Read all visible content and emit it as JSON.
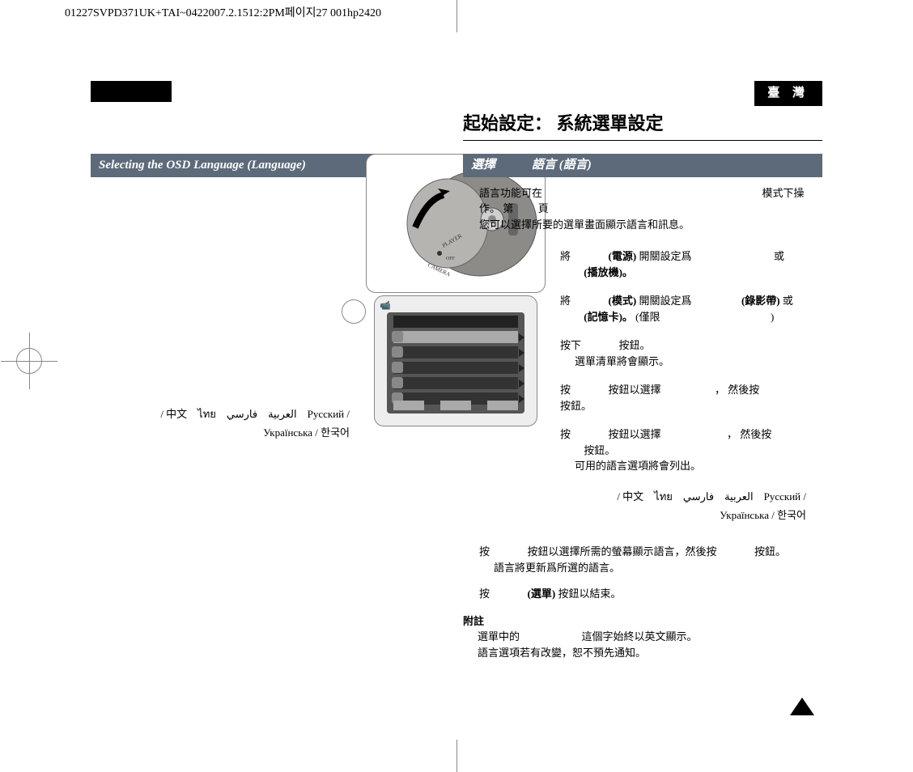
{
  "header_line": "01227SVPD371UK+TAI~0422007.2.1512:2PM페이지27 001hp2420",
  "region": "臺 灣",
  "right_title": "起始設定： 系統選單設定",
  "left_title": "",
  "left_subhead": "Selecting the OSD Language (Language)",
  "right_subhead": "選擇　　　語言 (語言)",
  "intro_line1": "語言功能可在",
  "intro_mode": "模式下操",
  "intro_line2a": "作。  第",
  "intro_line2b": "頁",
  "intro_line3": "您可以選擇所要的選單畫面顯示語言和訊息。",
  "step1a": "將",
  "step1b": "(電源)",
  "step1c": "開關設定爲",
  "step1d": "或",
  "step1e": "(播放機)。",
  "step2a": "將",
  "step2b": "(模式)",
  "step2c": "開關設定爲",
  "step2d": "(錄影帶)",
  "step2e": "或",
  "step2f": "(記憶卡)。",
  "step2g": "(僅限",
  "step2h": ")",
  "step3a": "按下",
  "step3b": "按鈕。",
  "step3c": "選單清單將會顯示。",
  "step4a": "按",
  "step4b": "按鈕以選擇",
  "step4c": "， 然後按",
  "step4d": "按鈕。",
  "step5a": "按",
  "step5b": "按鈕以選擇",
  "step5c": "， 然後按",
  "step5d": "按鈕。",
  "step5e": "可用的語言選項將會列出。",
  "langs_line1": "/ 中文　ไทย　العربية　فارسي　Русский /",
  "langs_line2": "Українська / 한국어",
  "step6a": "按",
  "step6b": "按鈕以選擇所需的螢幕顯示語言，然後按",
  "step6c": "按鈕。",
  "step6d": "語言將更新爲所選的語言。",
  "step7a": "按",
  "step7b": "(選單)",
  "step7c": "按鈕以結束。",
  "note_title": "附註",
  "note1a": "選單中的",
  "note1b": "這個字始終以英文顯示。",
  "note2": "語言選項若有改變，恕不預先通知。"
}
